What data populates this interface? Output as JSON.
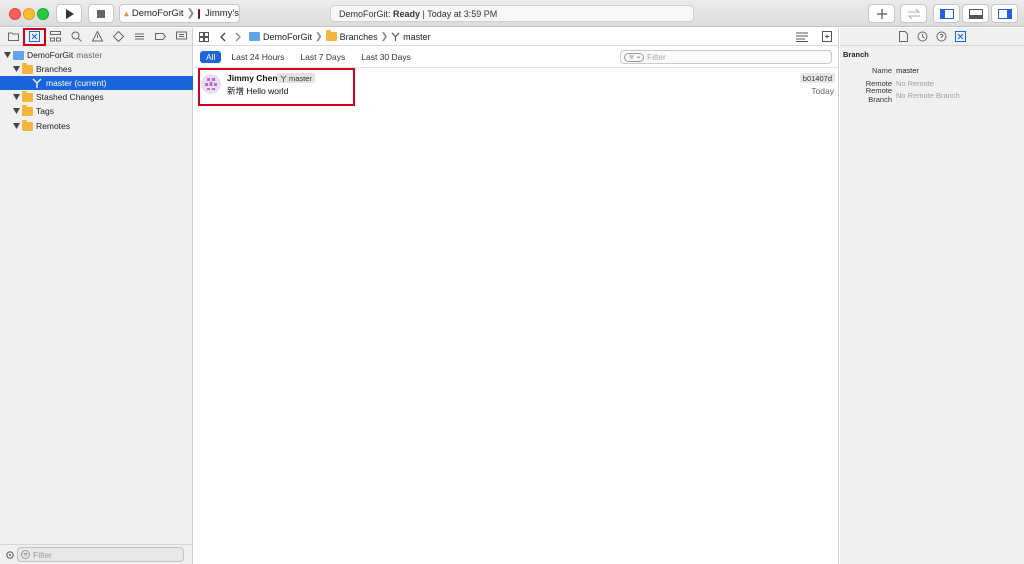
{
  "toolbar": {
    "scheme_app": "DemoForGit",
    "scheme_device": "Jimmy's",
    "activity_prefix": "DemoForGit: ",
    "activity_status": "Ready",
    "activity_time": " | Today at 3:59 PM"
  },
  "navigator": {
    "tree": {
      "repo_name": "DemoForGit",
      "repo_branch": "master",
      "branches_label": "Branches",
      "current_branch": "master (current)",
      "stashed_label": "Stashed Changes",
      "tags_label": "Tags",
      "remotes_label": "Remotes"
    },
    "filter_placeholder": "Filter"
  },
  "editor": {
    "breadcrumb": [
      "DemoForGit",
      "Branches",
      "master"
    ],
    "scopes": [
      "All",
      "Last 24 Hours",
      "Last 7 Days",
      "Last 30 Days"
    ],
    "filter_placeholder": "Filter",
    "commit": {
      "author": "Jimmy Chen",
      "branch": "master",
      "message": "新增 Hello world",
      "hash": "b01407d",
      "date": "Today"
    }
  },
  "inspector": {
    "section_title": "Branch",
    "name_label": "Name",
    "name_value": "master",
    "remote_label": "Remote",
    "remote_value": "No Remote",
    "remote_branch_label": "Remote Branch",
    "remote_branch_value": "No Remote Branch"
  },
  "colors": {
    "selection": "#1a64dc",
    "highlight": "#d0021b",
    "folder": "#f3b63c"
  }
}
